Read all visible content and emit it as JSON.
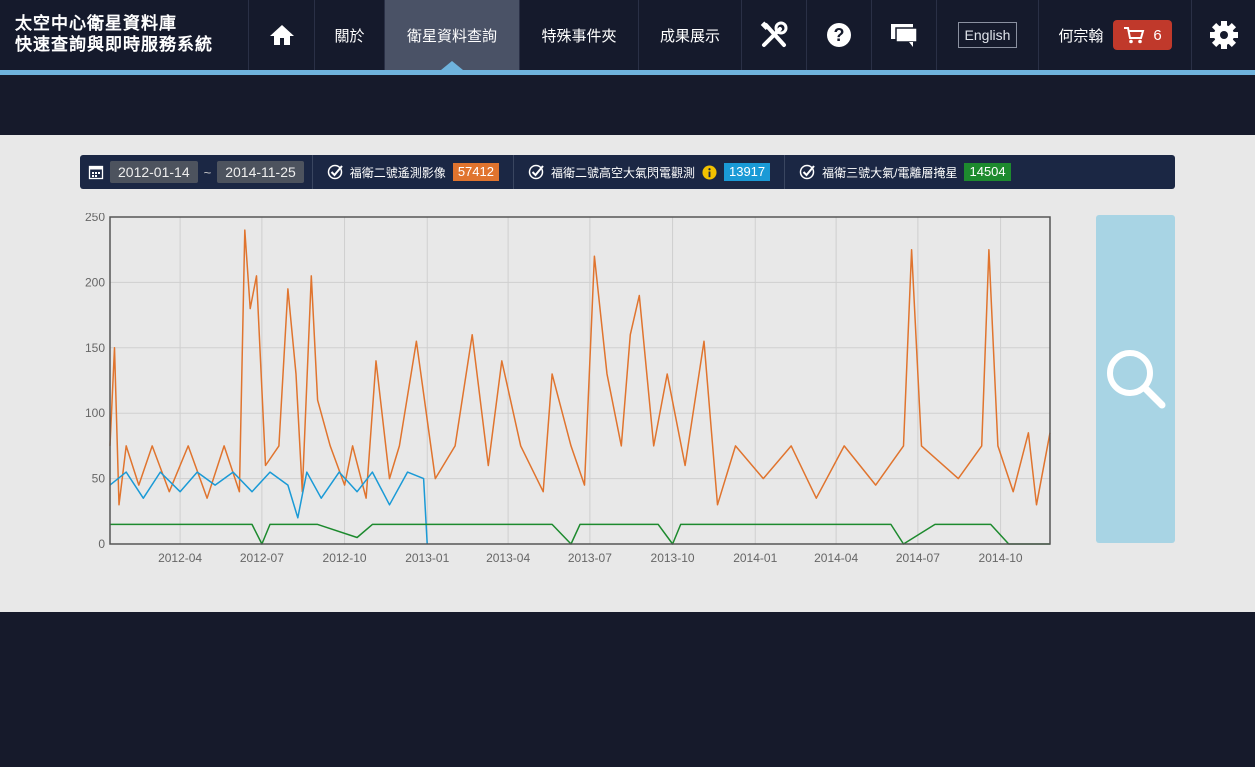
{
  "brand": {
    "line1": "太空中心衛星資料庫",
    "line2": "快速查詢與即時服務系統"
  },
  "nav": {
    "home_icon": "home-icon",
    "about": "關於",
    "query": "衛星資料查詢",
    "special_events": "特殊事件夾",
    "showcase": "成果展示",
    "tools_icon": "tools-icon",
    "help_icon": "question-icon",
    "chat_icon": "chat-icon",
    "language": "English",
    "user": "何宗翰",
    "cart_count": "6",
    "settings_icon": "gear-icon"
  },
  "filter": {
    "date_start": "2012-01-14",
    "date_sep": "~",
    "date_end": "2014-11-25",
    "datasets": [
      {
        "label": "福衛二號遙測影像",
        "count": "57412",
        "color": "#e0742e"
      },
      {
        "label": "福衛二號高空大氣閃電觀測",
        "count": "13917",
        "color": "#1a9ad6"
      },
      {
        "label": "福衛三號大氣/電離層掩星",
        "count": "14504",
        "color": "#1d8a2e"
      }
    ]
  },
  "colors": {
    "nav_bg": "#151a2c",
    "accent": "#6fb3dd",
    "panel": "#e8e8e8",
    "cart": "#c0392b",
    "search": "#a8d4e4"
  },
  "chart_data": {
    "type": "line",
    "x_ticks": [
      "2012-04",
      "2012-07",
      "2012-10",
      "2013-01",
      "2013-04",
      "2013-07",
      "2013-10",
      "2014-01",
      "2014-04",
      "2014-07",
      "2014-10"
    ],
    "y_ticks": [
      "0",
      "50",
      "100",
      "150",
      "200",
      "250"
    ],
    "ylim": [
      0,
      250
    ],
    "xlim": [
      "2012-01-14",
      "2014-11-25"
    ],
    "grid": true,
    "series": [
      {
        "color": "#e0742e",
        "stroke_width": 1.5,
        "values": [
          [
            "2012-01-14",
            75
          ],
          [
            "2012-01-19",
            150
          ],
          [
            "2012-01-24",
            30
          ],
          [
            "2012-02-01",
            75
          ],
          [
            "2012-02-15",
            45
          ],
          [
            "2012-03-01",
            75
          ],
          [
            "2012-03-20",
            40
          ],
          [
            "2012-04-10",
            75
          ],
          [
            "2012-05-01",
            35
          ],
          [
            "2012-05-20",
            75
          ],
          [
            "2012-06-06",
            40
          ],
          [
            "2012-06-12",
            240
          ],
          [
            "2012-06-18",
            180
          ],
          [
            "2012-06-25",
            205
          ],
          [
            "2012-07-05",
            60
          ],
          [
            "2012-07-20",
            75
          ],
          [
            "2012-07-30",
            195
          ],
          [
            "2012-08-08",
            130
          ],
          [
            "2012-08-15",
            40
          ],
          [
            "2012-08-25",
            205
          ],
          [
            "2012-09-01",
            110
          ],
          [
            "2012-09-15",
            75
          ],
          [
            "2012-10-01",
            45
          ],
          [
            "2012-10-10",
            75
          ],
          [
            "2012-10-25",
            35
          ],
          [
            "2012-11-05",
            140
          ],
          [
            "2012-11-20",
            50
          ],
          [
            "2012-12-01",
            75
          ],
          [
            "2012-12-20",
            155
          ],
          [
            "2013-01-10",
            50
          ],
          [
            "2013-02-01",
            75
          ],
          [
            "2013-02-20",
            160
          ],
          [
            "2013-03-10",
            60
          ],
          [
            "2013-03-25",
            140
          ],
          [
            "2013-04-15",
            75
          ],
          [
            "2013-05-10",
            40
          ],
          [
            "2013-05-20",
            130
          ],
          [
            "2013-06-10",
            75
          ],
          [
            "2013-06-25",
            45
          ],
          [
            "2013-07-06",
            220
          ],
          [
            "2013-07-20",
            130
          ],
          [
            "2013-08-05",
            75
          ],
          [
            "2013-08-15",
            160
          ],
          [
            "2013-08-25",
            190
          ],
          [
            "2013-09-10",
            75
          ],
          [
            "2013-09-25",
            130
          ],
          [
            "2013-10-15",
            60
          ],
          [
            "2013-11-05",
            155
          ],
          [
            "2013-11-20",
            30
          ],
          [
            "2013-12-10",
            75
          ],
          [
            "2014-01-10",
            50
          ],
          [
            "2014-02-10",
            75
          ],
          [
            "2014-03-10",
            35
          ],
          [
            "2014-04-10",
            75
          ],
          [
            "2014-05-15",
            45
          ],
          [
            "2014-06-15",
            75
          ],
          [
            "2014-06-24",
            225
          ],
          [
            "2014-07-05",
            75
          ],
          [
            "2014-08-15",
            50
          ],
          [
            "2014-09-10",
            75
          ],
          [
            "2014-09-18",
            225
          ],
          [
            "2014-09-28",
            75
          ],
          [
            "2014-10-15",
            40
          ],
          [
            "2014-11-01",
            85
          ],
          [
            "2014-11-10",
            30
          ],
          [
            "2014-11-25",
            85
          ]
        ]
      },
      {
        "color": "#1a9ad6",
        "stroke_width": 1.5,
        "values": [
          [
            "2012-01-14",
            45
          ],
          [
            "2012-02-01",
            55
          ],
          [
            "2012-02-20",
            35
          ],
          [
            "2012-03-10",
            55
          ],
          [
            "2012-04-01",
            40
          ],
          [
            "2012-04-20",
            55
          ],
          [
            "2012-05-10",
            45
          ],
          [
            "2012-05-30",
            55
          ],
          [
            "2012-06-20",
            40
          ],
          [
            "2012-07-10",
            55
          ],
          [
            "2012-07-30",
            45
          ],
          [
            "2012-08-10",
            20
          ],
          [
            "2012-08-20",
            55
          ],
          [
            "2012-09-05",
            35
          ],
          [
            "2012-09-25",
            55
          ],
          [
            "2012-10-15",
            40
          ],
          [
            "2012-11-01",
            55
          ],
          [
            "2012-11-20",
            30
          ],
          [
            "2012-12-10",
            55
          ],
          [
            "2012-12-28",
            50
          ],
          [
            "2013-01-01",
            0
          ]
        ]
      },
      {
        "color": "#1d8a2e",
        "stroke_width": 1.5,
        "values": [
          [
            "2012-01-14",
            15
          ],
          [
            "2012-03-15",
            15
          ],
          [
            "2012-06-20",
            15
          ],
          [
            "2012-07-01",
            0
          ],
          [
            "2012-07-10",
            15
          ],
          [
            "2012-09-01",
            15
          ],
          [
            "2012-10-15",
            5
          ],
          [
            "2012-11-01",
            15
          ],
          [
            "2013-05-20",
            15
          ],
          [
            "2013-06-10",
            0
          ],
          [
            "2013-06-20",
            15
          ],
          [
            "2013-09-15",
            15
          ],
          [
            "2013-10-01",
            0
          ],
          [
            "2013-10-10",
            15
          ],
          [
            "2014-06-01",
            15
          ],
          [
            "2014-06-15",
            0
          ],
          [
            "2014-07-20",
            15
          ],
          [
            "2014-09-20",
            15
          ],
          [
            "2014-10-10",
            0
          ],
          [
            "2014-11-25",
            0
          ]
        ]
      }
    ]
  }
}
